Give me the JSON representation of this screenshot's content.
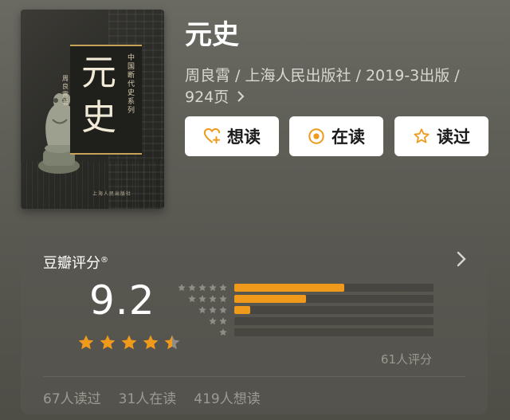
{
  "cover": {
    "title_glyphs": "元史",
    "series": "中国断代史系列",
    "author": "周良霄著",
    "publisher": "上海人民出版社"
  },
  "book": {
    "title": "元史",
    "meta": "周良霄 / 上海人民出版社 / 2019-3出版 / 924页"
  },
  "actions": [
    {
      "label": "想读",
      "icon": "heart-plus-icon"
    },
    {
      "label": "在读",
      "icon": "target-circle-icon"
    },
    {
      "label": "读过",
      "icon": "star-outline-icon"
    }
  ],
  "rating": {
    "header": "豆瓣评分",
    "score": "9.2",
    "stars": 4.5,
    "count_text": "61人评分",
    "distribution": [
      {
        "stars": 5,
        "fraction": 0.55
      },
      {
        "stars": 4,
        "fraction": 0.36
      },
      {
        "stars": 3,
        "fraction": 0.08
      },
      {
        "stars": 2,
        "fraction": 0.0
      },
      {
        "stars": 1,
        "fraction": 0.0
      }
    ],
    "stats": [
      "67人读过",
      "31人在读",
      "419人想读"
    ]
  },
  "colors": {
    "accent": "#f09a1c",
    "star_gray": "#8f8d86"
  }
}
